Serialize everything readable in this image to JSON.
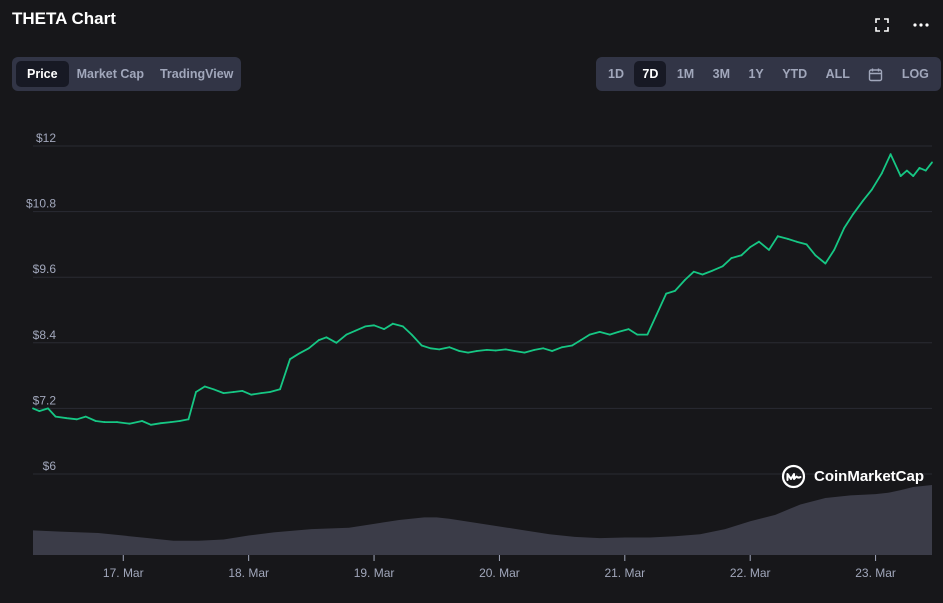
{
  "header": {
    "title": "THETA Chart"
  },
  "icons": {
    "expand": "expand-icon",
    "more": "more-icon",
    "calendar": "calendar-icon",
    "logo": "coinmarketcap-logo-icon"
  },
  "view_tabs": [
    {
      "label": "Price",
      "active": true
    },
    {
      "label": "Market Cap",
      "active": false
    },
    {
      "label": "TradingView",
      "active": false
    }
  ],
  "range_tabs": [
    {
      "label": "1D",
      "active": false
    },
    {
      "label": "7D",
      "active": true
    },
    {
      "label": "1M",
      "active": false
    },
    {
      "label": "3M",
      "active": false
    },
    {
      "label": "1Y",
      "active": false
    },
    {
      "label": "YTD",
      "active": false
    },
    {
      "label": "ALL",
      "active": false
    }
  ],
  "log_label": "LOG",
  "watermark": "CoinMarketCap",
  "colors": {
    "background": "#17171a",
    "line": "#16c784",
    "volume": "#3b3c48",
    "grid": "#2a2b33",
    "tick": "#a1a7bb"
  },
  "chart_data": {
    "type": "line",
    "title": "",
    "xlabel": "",
    "ylabel": "",
    "y_ticks": [
      "$6",
      "$7.2",
      "$8.4",
      "$9.6",
      "$10.8",
      "$12"
    ],
    "y_tick_values": [
      6,
      7.2,
      8.4,
      9.6,
      10.8,
      12
    ],
    "ylim": [
      6,
      12
    ],
    "x_ticks": [
      "17. Mar",
      "18. Mar",
      "19. Mar",
      "20. Mar",
      "21. Mar",
      "22. Mar",
      "23. Mar"
    ],
    "x_tick_positions": [
      1,
      2,
      3,
      4,
      5,
      6,
      7
    ],
    "xlim": [
      0.28,
      7.45
    ],
    "grid": true,
    "series": [
      {
        "x": [
          0.28,
          0.33,
          0.4,
          0.46,
          0.55,
          0.63,
          0.7,
          0.78,
          0.85,
          0.95,
          1.05,
          1.15,
          1.22,
          1.3,
          1.38,
          1.45,
          1.52,
          1.58,
          1.65,
          1.72,
          1.8,
          1.88,
          1.95,
          2.02,
          2.1,
          2.17,
          2.25,
          2.33,
          2.4,
          2.48,
          2.56,
          2.62,
          2.7,
          2.78,
          2.85,
          2.93,
          3.0,
          3.08,
          3.15,
          3.23,
          3.3,
          3.38,
          3.45,
          3.52,
          3.6,
          3.68,
          3.75,
          3.82,
          3.9,
          3.97,
          4.05,
          4.12,
          4.2,
          4.28,
          4.35,
          4.42,
          4.5,
          4.58,
          4.65,
          4.72,
          4.8,
          4.88,
          4.95,
          5.03,
          5.1,
          5.18,
          5.25,
          5.33,
          5.4,
          5.48,
          5.55,
          5.62,
          5.7,
          5.78,
          5.85,
          5.93,
          6.0,
          6.07,
          6.15,
          6.22,
          6.3,
          6.37,
          6.45,
          6.52,
          6.6,
          6.67,
          6.75,
          6.82,
          6.9,
          6.97,
          7.05,
          7.12,
          7.2,
          7.25,
          7.3,
          7.35,
          7.4,
          7.45
        ],
        "y": [
          7.2,
          7.15,
          7.2,
          7.05,
          7.02,
          7.0,
          7.05,
          6.97,
          6.95,
          6.95,
          6.92,
          6.97,
          6.9,
          6.93,
          6.95,
          6.97,
          7.0,
          7.5,
          7.6,
          7.55,
          7.48,
          7.5,
          7.52,
          7.45,
          7.48,
          7.5,
          7.55,
          8.1,
          8.2,
          8.3,
          8.45,
          8.5,
          8.4,
          8.55,
          8.62,
          8.7,
          8.72,
          8.65,
          8.75,
          8.7,
          8.55,
          8.35,
          8.3,
          8.28,
          8.32,
          8.25,
          8.22,
          8.25,
          8.27,
          8.26,
          8.28,
          8.25,
          8.22,
          8.27,
          8.3,
          8.25,
          8.32,
          8.35,
          8.45,
          8.55,
          8.6,
          8.55,
          8.6,
          8.65,
          8.55,
          8.55,
          8.9,
          9.3,
          9.35,
          9.55,
          9.7,
          9.65,
          9.72,
          9.8,
          9.95,
          10.0,
          10.15,
          10.25,
          10.1,
          10.35,
          10.3,
          10.25,
          10.2,
          10.0,
          9.85,
          10.1,
          10.5,
          10.75,
          11.0,
          11.2,
          11.5,
          11.85,
          11.45,
          11.55,
          11.45,
          11.6,
          11.55,
          11.7
        ]
      }
    ],
    "volume": {
      "x": [
        0.28,
        0.5,
        0.8,
        1.0,
        1.2,
        1.4,
        1.6,
        1.8,
        2.0,
        2.2,
        2.5,
        2.8,
        3.0,
        3.2,
        3.4,
        3.5,
        3.6,
        3.8,
        4.0,
        4.2,
        4.4,
        4.6,
        4.8,
        5.0,
        5.2,
        5.4,
        5.6,
        5.8,
        6.0,
        6.2,
        6.4,
        6.6,
        6.8,
        7.0,
        7.1,
        7.2,
        7.3,
        7.45
      ],
      "values": [
        0.38,
        0.36,
        0.34,
        0.3,
        0.26,
        0.22,
        0.22,
        0.24,
        0.3,
        0.35,
        0.4,
        0.42,
        0.48,
        0.54,
        0.58,
        0.58,
        0.56,
        0.5,
        0.44,
        0.38,
        0.32,
        0.28,
        0.26,
        0.27,
        0.27,
        0.29,
        0.32,
        0.4,
        0.52,
        0.62,
        0.78,
        0.88,
        0.92,
        0.94,
        0.96,
        1.0,
        1.05,
        1.08
      ]
    }
  }
}
